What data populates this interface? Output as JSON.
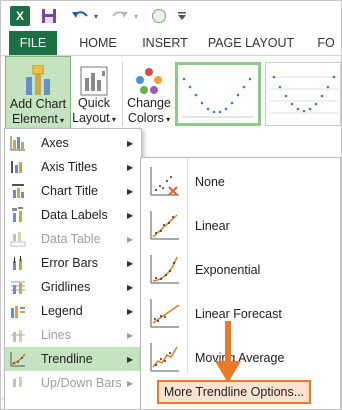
{
  "qat": {
    "app_icon": "X",
    "icons": [
      "excel-icon",
      "save-icon",
      "undo-icon",
      "redo-icon",
      "shape-icon",
      "customize-icon"
    ]
  },
  "tabs": [
    "FILE",
    "HOME",
    "INSERT",
    "PAGE LAYOUT",
    "FO"
  ],
  "ribbon": {
    "add_chart_element": {
      "line1": "Add Chart",
      "line2": "Element"
    },
    "quick_layout": {
      "line1": "Quick",
      "line2": "Layout"
    },
    "change_colors": {
      "line1": "Change",
      "line2": "Colors"
    }
  },
  "menu": {
    "items": [
      {
        "label": "Axes",
        "disabled": false
      },
      {
        "label": "Axis Titles",
        "disabled": false
      },
      {
        "label": "Chart Title",
        "disabled": false
      },
      {
        "label": "Data Labels",
        "disabled": false
      },
      {
        "label": "Data Table",
        "disabled": true
      },
      {
        "label": "Error Bars",
        "disabled": false
      },
      {
        "label": "Gridlines",
        "disabled": false
      },
      {
        "label": "Legend",
        "disabled": false
      },
      {
        "label": "Lines",
        "disabled": true
      },
      {
        "label": "Trendline",
        "disabled": false,
        "highlighted": true
      },
      {
        "label": "Up/Down Bars",
        "disabled": true
      }
    ]
  },
  "submenu": {
    "items": [
      "None",
      "Linear",
      "Exponential",
      "Linear Forecast",
      "Moving Average"
    ],
    "more": "More Trendline Options..."
  },
  "colors": {
    "excel_green": "#1d7044",
    "highlight": "#c5e3c0",
    "orange": "#e87a2a"
  }
}
